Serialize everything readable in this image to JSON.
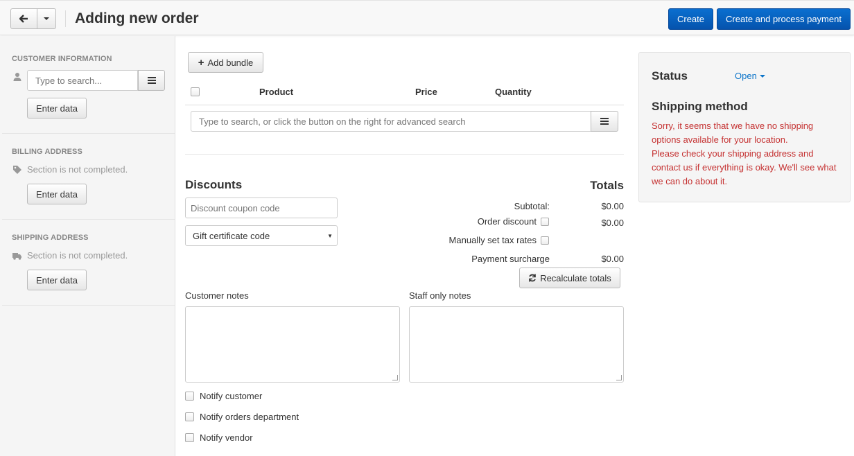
{
  "header": {
    "title": "Adding new order",
    "create_label": "Create",
    "create_pay_label": "Create and process payment"
  },
  "sidebar": {
    "customer": {
      "heading": "CUSTOMER INFORMATION",
      "search_placeholder": "Type to search...",
      "button": "Enter data"
    },
    "billing": {
      "heading": "BILLING ADDRESS",
      "note": "Section is not completed.",
      "button": "Enter data"
    },
    "shipping": {
      "heading": "SHIPPING ADDRESS",
      "note": "Section is not completed.",
      "button": "Enter data"
    }
  },
  "products": {
    "add_bundle": "Add bundle",
    "columns": [
      "Product",
      "Price",
      "Quantity"
    ],
    "search_placeholder": "Type to search, or click the button on the right for advanced search"
  },
  "discounts": {
    "heading": "Discounts",
    "coupon_placeholder": "Discount coupon code",
    "gift_select": "Gift certificate code"
  },
  "totals": {
    "heading": "Totals",
    "subtotal_label": "Subtotal:",
    "subtotal_value": "$0.00",
    "order_discount_label": "Order discount",
    "order_discount_value": "$0.00",
    "tax_label": "Manually set tax rates",
    "surcharge_label": "Payment surcharge",
    "surcharge_value": "$0.00",
    "recalc": "Recalculate totals"
  },
  "notes": {
    "customer_label": "Customer notes",
    "staff_label": "Staff only notes"
  },
  "notify": {
    "customer": "Notify customer",
    "orders": "Notify orders department",
    "vendor": "Notify vendor"
  },
  "status_panel": {
    "status_label": "Status",
    "status_value": "Open",
    "shipping_title": "Shipping method",
    "shipping_msg_1": "Sorry, it seems that we have no shipping options available for your location.",
    "shipping_msg_2": "Please check your shipping address and contact us if everything is okay. We'll see what we can do about it."
  },
  "colors": {
    "primary": "#0a6fd0",
    "link": "#0b74c9",
    "error": "#c53232"
  }
}
